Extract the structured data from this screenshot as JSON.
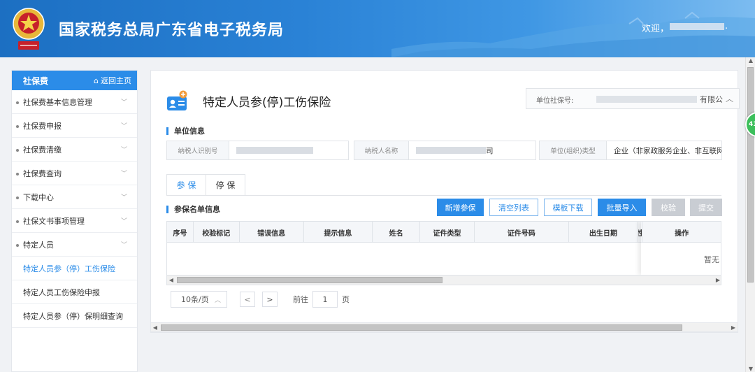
{
  "header": {
    "title": "国家税务总局广东省电子税务局",
    "welcome": "欢迎，",
    "welcome_suffix": "."
  },
  "sidebar": {
    "title": "社保费",
    "home_label": "返回主页",
    "items": [
      {
        "label": "社保费基本信息管理"
      },
      {
        "label": "社保费申报"
      },
      {
        "label": "社保费清缴"
      },
      {
        "label": "社保费查询"
      },
      {
        "label": "下载中心"
      },
      {
        "label": "社保文书事项管理"
      },
      {
        "label": "特定人员"
      }
    ],
    "subitems": [
      {
        "label": "特定人员参（停）工伤保险",
        "active": true
      },
      {
        "label": "特定人员工伤保险申报",
        "active": false
      },
      {
        "label": "特定人员参（停）保明细查询",
        "active": false
      }
    ]
  },
  "page": {
    "title": "特定人员参(停)工伤保险",
    "ssn_label": "单位社保号:",
    "ssn_value_suffix": "有限公"
  },
  "unit_info": {
    "section_title": "单位信息",
    "taxpayer_id_label": "纳税人识别号",
    "taxpayer_name_label": "纳税人名称",
    "taxpayer_name_suffix": "司",
    "org_type_label": "单位(组织)类型",
    "org_type_value": "企业（非家政服务企业、非互联网"
  },
  "tabs": [
    {
      "label": "参 保",
      "active": true
    },
    {
      "label": "停 保",
      "active": false
    }
  ],
  "roster": {
    "section_title": "参保名单信息",
    "buttons": {
      "add": "新增参保",
      "clear": "清空列表",
      "template": "模板下载",
      "import": "批量导入",
      "validate": "校验",
      "submit": "提交"
    },
    "columns": [
      "序号",
      "校验标记",
      "错误信息",
      "提示信息",
      "姓名",
      "证件类型",
      "证件号码",
      "出生日期",
      "性",
      "操作"
    ],
    "empty_text": "暂无"
  },
  "pager": {
    "page_size": "10条/页",
    "goto_prefix": "前往",
    "page": "1",
    "goto_suffix": "页"
  },
  "float_badge": "41",
  "colors": {
    "accent": "#2b8ce8",
    "header_start": "#1c6fc2",
    "disabled": "#c9cdd3"
  }
}
